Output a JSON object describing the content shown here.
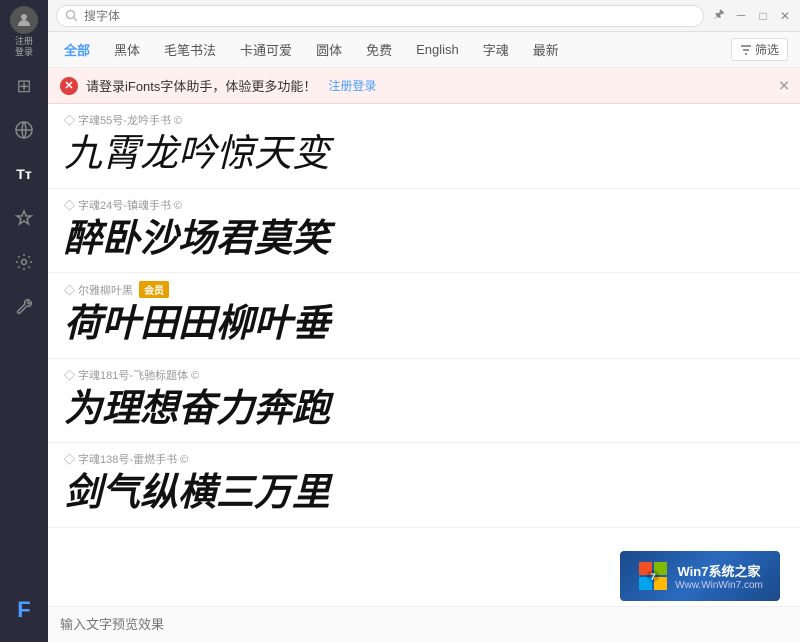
{
  "sidebar": {
    "avatar_label": "注册\n登录",
    "icons": [
      {
        "name": "home-icon",
        "symbol": "⊞",
        "active": false
      },
      {
        "name": "globe-icon",
        "symbol": "◉",
        "active": false
      },
      {
        "name": "font-icon",
        "symbol": "Tт",
        "active": false
      },
      {
        "name": "settings-icon",
        "symbol": "✦",
        "active": false
      },
      {
        "name": "tool-icon",
        "symbol": "🔧",
        "active": false
      }
    ],
    "brand_label": "F"
  },
  "titlebar": {
    "search_placeholder": "搜字体",
    "btn_min": "－",
    "btn_max": "□",
    "btn_pin": "🖈",
    "btn_close": "✕"
  },
  "filterbar": {
    "items": [
      {
        "label": "全部",
        "active": true
      },
      {
        "label": "黑体",
        "active": false
      },
      {
        "label": "毛笔书法",
        "active": false
      },
      {
        "label": "卡通可爱",
        "active": false
      },
      {
        "label": "圆体",
        "active": false
      },
      {
        "label": "免费",
        "active": false
      },
      {
        "label": "English",
        "active": false
      },
      {
        "label": "字魂",
        "active": false
      },
      {
        "label": "最新",
        "active": false
      }
    ],
    "filter_btn": "筛选"
  },
  "alert": {
    "text": "请登录iFonts字体助手，体验更多功能！",
    "link_text": "注册登录",
    "close": "✕"
  },
  "fonts": [
    {
      "meta": "字魂55号-龙吟手书 ©",
      "preview": "九霄龙吟惊天变",
      "style": "style1",
      "vip": false
    },
    {
      "meta": "字魂24号-镇魂手书 ©",
      "preview": "醉卧沙场君莫笑",
      "style": "style2",
      "vip": false
    },
    {
      "meta": "尔雅柳叶黑",
      "preview": "荷叶田田柳叶垂",
      "style": "style3",
      "vip": true,
      "vip_label": "会员"
    },
    {
      "meta": "字魂181号-飞驰标题体 ©",
      "preview": "为理想奋力奔跑",
      "style": "style4",
      "vip": false
    },
    {
      "meta": "字魂138号-雷燃手书 ©",
      "preview": "剑气纵横三万里",
      "style": "style5",
      "vip": false
    }
  ],
  "preview_input": {
    "placeholder": "输入文字预览效果"
  },
  "watermark": {
    "line1": "Win7系统之家",
    "line2": "Www.WinWin7.com"
  }
}
